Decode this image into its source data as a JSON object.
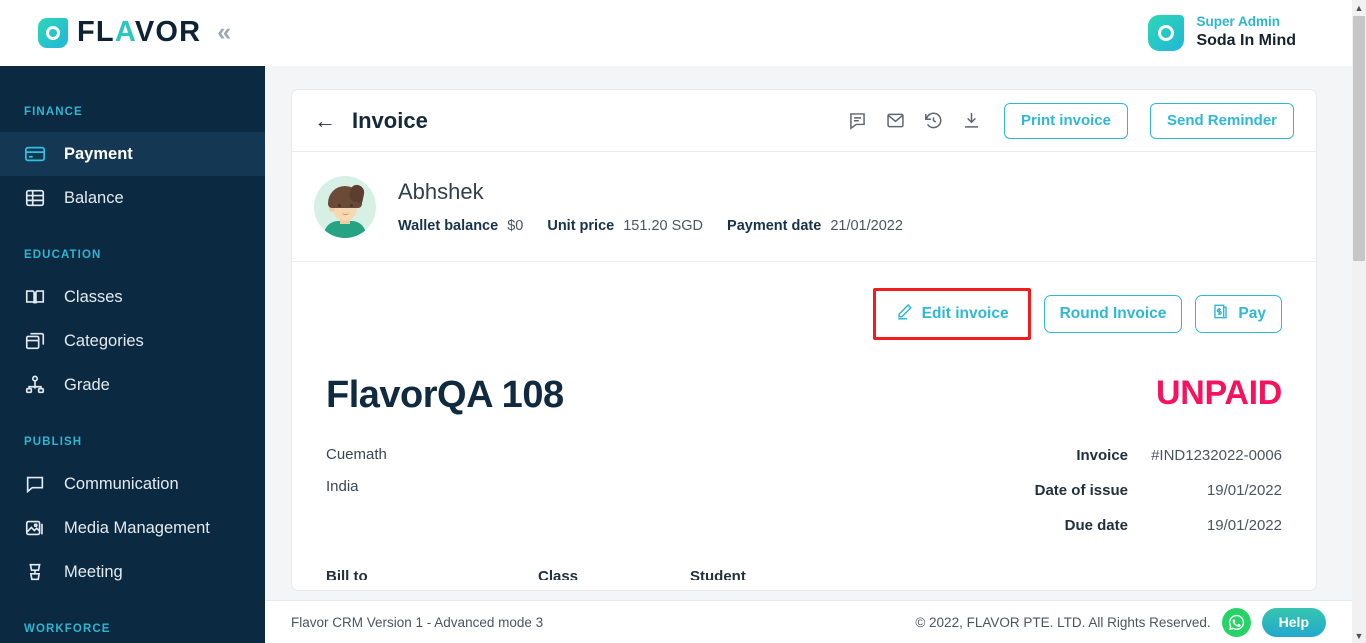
{
  "brand": {
    "name_prefix": "FL",
    "name_accent": "A",
    "name_suffix": "VOR",
    "collapse_icon": "«",
    "logo_icon": "flavor-logo-icon",
    "accent_color": "#2CC7BE"
  },
  "header": {
    "user_role": "Super Admin",
    "user_name": "Soda In Mind"
  },
  "sidebar": {
    "groups": [
      {
        "label": "FINANCE"
      },
      {
        "label": "EDUCATION"
      },
      {
        "label": "PUBLISH"
      },
      {
        "label": "WORKFORCE"
      }
    ],
    "items": [
      {
        "label": "Payment",
        "icon": "credit-card-icon",
        "active": true
      },
      {
        "label": "Balance",
        "icon": "database-icon",
        "active": false
      },
      {
        "label": "Classes",
        "icon": "book-open-icon",
        "active": false
      },
      {
        "label": "Categories",
        "icon": "boxes-icon",
        "active": false
      },
      {
        "label": "Grade",
        "icon": "hierarchy-icon",
        "active": false
      },
      {
        "label": "Communication",
        "icon": "chat-bubble-icon",
        "active": false
      },
      {
        "label": "Media Management",
        "icon": "image-stack-icon",
        "active": false
      },
      {
        "label": "Meeting",
        "icon": "podium-icon",
        "active": false
      }
    ]
  },
  "card": {
    "back_icon": "back-arrow-icon",
    "title": "Invoice",
    "tools": [
      {
        "name": "comment-icon"
      },
      {
        "name": "envelope-icon"
      },
      {
        "name": "history-icon"
      },
      {
        "name": "download-icon"
      }
    ],
    "print_label": "Print invoice",
    "reminder_label": "Send Reminder"
  },
  "client": {
    "name": "Abhshek",
    "facts": [
      {
        "key": "Wallet balance",
        "value": "$0"
      },
      {
        "key": "Unit price",
        "value": "151.20 SGD"
      },
      {
        "key": "Payment date",
        "value": "21/01/2022"
      }
    ]
  },
  "actions": {
    "edit_label": "Edit invoice",
    "edit_icon": "pencil-icon",
    "round_label": "Round Invoice",
    "pay_label": "Pay",
    "pay_icon": "money-bill-icon",
    "highlight_color": "#F31B1B"
  },
  "invoice": {
    "title": "FlavorQA 108",
    "status": "UNPAID",
    "status_color": "#F5135E",
    "from_company": "Cuemath",
    "from_country": "India",
    "rows": [
      {
        "key": "Invoice",
        "value": "#IND1232022-0006"
      },
      {
        "key": "Date of issue",
        "value": "19/01/2022"
      },
      {
        "key": "Due date",
        "value": "19/01/2022"
      }
    ],
    "table_headers": [
      "Bill to",
      "Class",
      "Student"
    ]
  },
  "footer": {
    "version": "Flavor CRM Version 1 - Advanced mode 3",
    "copyright": "© 2022, FLAVOR PTE. LTD. All Rights Reserved.",
    "whatsapp_icon": "whatsapp-icon",
    "help_label": "Help"
  },
  "scrollbar": {
    "up_icon": "chevron-up-icon",
    "down_icon": "chevron-down-icon"
  }
}
